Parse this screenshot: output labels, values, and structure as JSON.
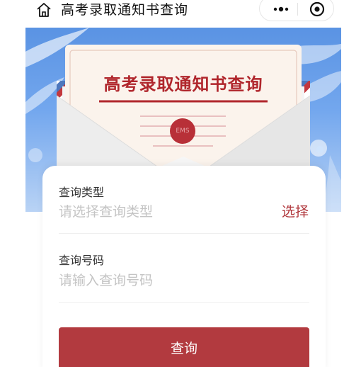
{
  "nav": {
    "title": "高考录取通知书查询",
    "home_icon": "home-icon",
    "more_icon": "more-dots-icon",
    "close_icon": "target-circle-icon"
  },
  "hero": {
    "letter_title": "高考录取通知书查询",
    "stamp_text": "EMS",
    "colors": {
      "sky": "#5a93e3",
      "title": "#b0262c",
      "stamp": "#b83038"
    }
  },
  "form": {
    "type_label": "查询类型",
    "type_placeholder": "请选择查询类型",
    "select_action": "选择",
    "number_label": "查询号码",
    "number_placeholder": "请输入查询号码",
    "submit_label": "查询"
  },
  "colors": {
    "accent": "#b23a3f",
    "placeholder": "#c4c4c4"
  }
}
